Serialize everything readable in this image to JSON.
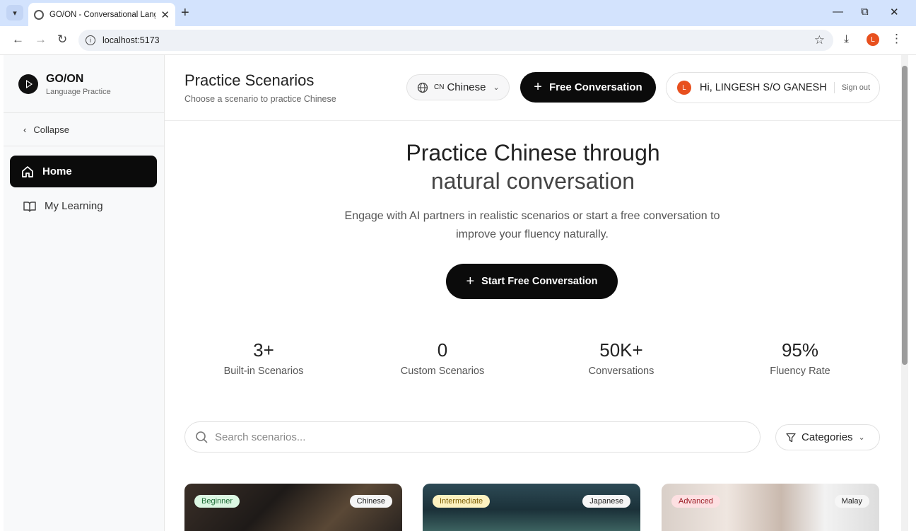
{
  "browser": {
    "tab_title": "GO/ON - Conversational Language Practice",
    "url": "localhost:5173",
    "profile_initial": "L"
  },
  "sidebar": {
    "brand_name": "GO/ON",
    "brand_sub": "Language Practice",
    "collapse_label": "Collapse",
    "items": [
      {
        "label": "Home"
      },
      {
        "label": "My Learning"
      }
    ]
  },
  "header": {
    "title": "Practice Scenarios",
    "subtitle": "Choose a scenario to practice Chinese",
    "language_code": "CN",
    "language": "Chinese",
    "free_conversation": "Free Conversation",
    "user_initial": "L",
    "greeting": "Hi, LINGESH S/O GANESH",
    "sign_out": "Sign out"
  },
  "hero": {
    "title_line1": "Practice Chinese through",
    "title_line2": "natural conversation",
    "subtitle": "Engage with AI partners in realistic scenarios or start a free conversation to improve your fluency naturally.",
    "start_button": "Start Free Conversation"
  },
  "stats": [
    {
      "value": "3+",
      "label": "Built-in Scenarios"
    },
    {
      "value": "0",
      "label": "Custom Scenarios"
    },
    {
      "value": "50K+",
      "label": "Conversations"
    },
    {
      "value": "95%",
      "label": "Fluency Rate"
    }
  ],
  "search": {
    "placeholder": "Search scenarios..."
  },
  "categories_label": "Categories",
  "cards": [
    {
      "level": "Beginner",
      "language": "Chinese"
    },
    {
      "level": "Intermediate",
      "language": "Japanese"
    },
    {
      "level": "Advanced",
      "language": "Malay"
    }
  ]
}
